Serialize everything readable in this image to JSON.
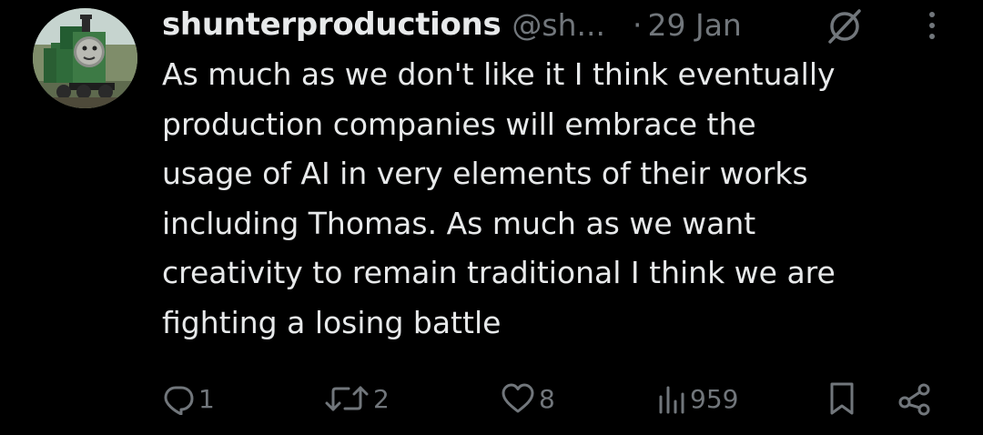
{
  "tweet": {
    "display_name": "shunterproductions",
    "handle": "@sh...",
    "separator": "·",
    "date": "29 Jan",
    "text": "As much as we don't like it I think eventually\nproduction companies will embrace the\nusage of AI in very elements of their works\nincluding Thomas. As much as we want\ncreativity to remain traditional I think we are\nfighting a losing battle",
    "actions": {
      "replies": "1",
      "reposts": "2",
      "likes": "8",
      "views": "959"
    }
  },
  "icons": {
    "avatar": "avatar-image",
    "grok": "grok-icon",
    "more": "more-vertical-icon",
    "reply": "reply-icon",
    "repost": "repost-icon",
    "like": "heart-icon",
    "views": "views-icon",
    "bookmark": "bookmark-icon",
    "share": "share-icon"
  },
  "colors": {
    "background": "#000000",
    "text_primary": "#e7e9ea",
    "text_secondary": "#71767b"
  }
}
